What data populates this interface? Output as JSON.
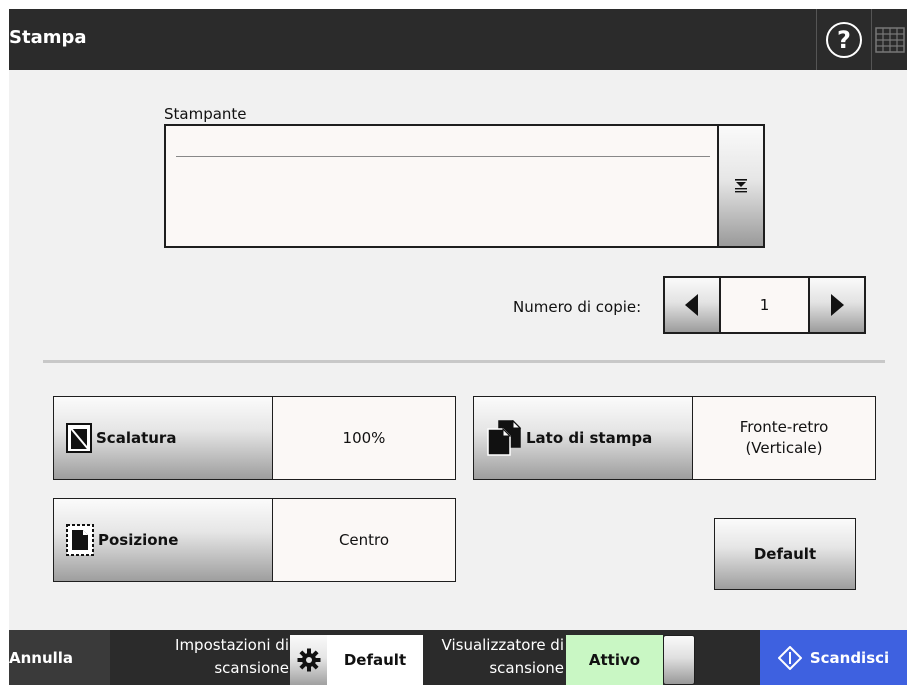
{
  "header": {
    "title": "Stampa",
    "help_label": "?"
  },
  "printer": {
    "label": "Stampante",
    "value": ""
  },
  "copies": {
    "label": "Numero di copie:",
    "value": "1"
  },
  "settings": {
    "scaling": {
      "label": "Scalatura",
      "value": "100%"
    },
    "print_side": {
      "label": "Lato di stampa",
      "value_line1": "Fronte-retro",
      "value_line2": "(Verticale)"
    },
    "position": {
      "label": "Posizione",
      "value": "Centro"
    },
    "default_label": "Default"
  },
  "footer": {
    "cancel_label": "Annulla",
    "scan_settings_label_line1": "Impostazioni di",
    "scan_settings_label_line2": "scansione",
    "scan_settings_value": "Default",
    "viewer_label_line1": "Visualizzatore di",
    "viewer_label_line2": "scansione",
    "viewer_value": "Attivo",
    "scan_label": "Scandisci"
  },
  "colors": {
    "titlebar_bg": "#2b2b2b",
    "content_bg": "#f1f1f1",
    "viewer_active_bg": "#c9f7c4",
    "scan_button_bg": "#3e61e0"
  },
  "icons": {
    "help": "help-icon",
    "keyboard": "keyboard-icon",
    "dropdown": "dropdown-arrow-icon",
    "decrement": "arrow-left-icon",
    "increment": "arrow-right-icon",
    "scaling": "scaling-icon",
    "print_side": "duplex-pages-icon",
    "position": "position-icon",
    "gear": "gear-icon",
    "scan": "scan-diamond-icon"
  }
}
